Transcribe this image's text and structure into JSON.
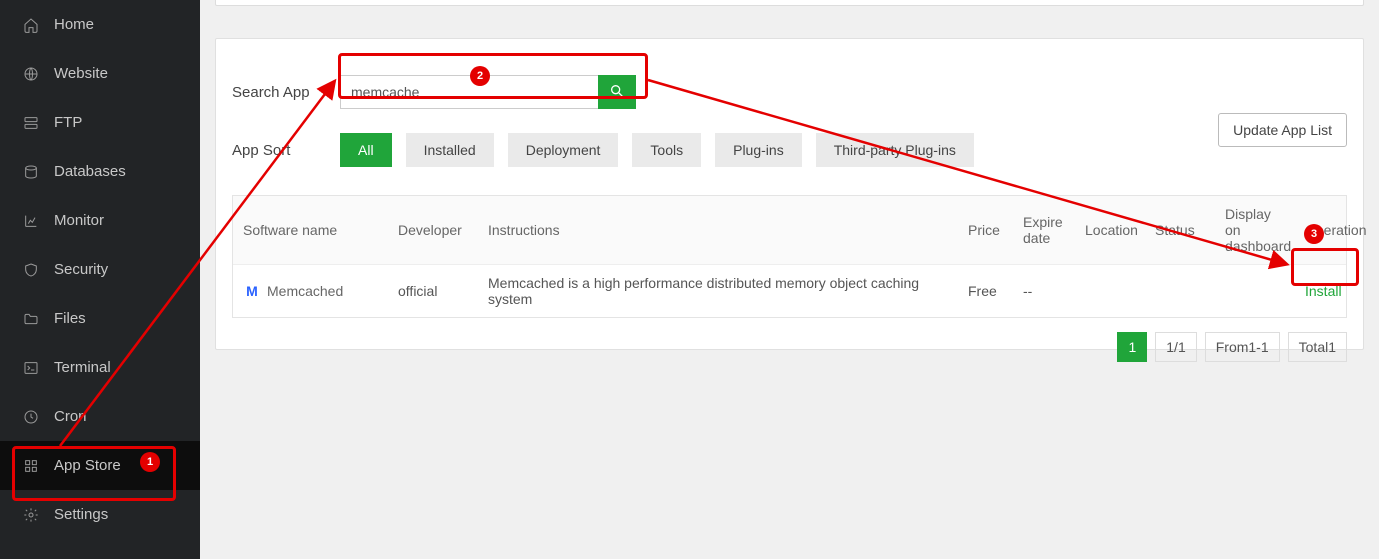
{
  "sidebar": {
    "items": [
      {
        "label": "Home"
      },
      {
        "label": "Website"
      },
      {
        "label": "FTP"
      },
      {
        "label": "Databases"
      },
      {
        "label": "Monitor"
      },
      {
        "label": "Security"
      },
      {
        "label": "Files"
      },
      {
        "label": "Terminal"
      },
      {
        "label": "Cron"
      },
      {
        "label": "App Store"
      },
      {
        "label": "Settings"
      }
    ]
  },
  "search": {
    "label": "Search App",
    "value": "memcache"
  },
  "sort": {
    "label": "App Sort",
    "buttons": [
      "All",
      "Installed",
      "Deployment",
      "Tools",
      "Plug-ins",
      "Third-party Plug-ins"
    ]
  },
  "update_button": "Update App List",
  "table": {
    "headers": {
      "name": "Software name",
      "dev": "Developer",
      "instr": "Instructions",
      "price": "Price",
      "expire": "Expire date",
      "loc": "Location",
      "status": "Status",
      "dash": "Display on dashboard",
      "op": "Operation"
    },
    "row": {
      "icon_letter": "M",
      "name": "Memcached",
      "dev": "official",
      "instr": "Memcached is a high performance distributed memory object caching system",
      "price": "Free",
      "expire": "--",
      "loc": "",
      "status": "",
      "dash": "",
      "op": "Install"
    }
  },
  "pager": {
    "current": "1",
    "pages": "1/1",
    "range": "From1-1",
    "total": "Total1"
  },
  "annotations": {
    "badge1": "1",
    "badge2": "2",
    "badge3": "3"
  }
}
